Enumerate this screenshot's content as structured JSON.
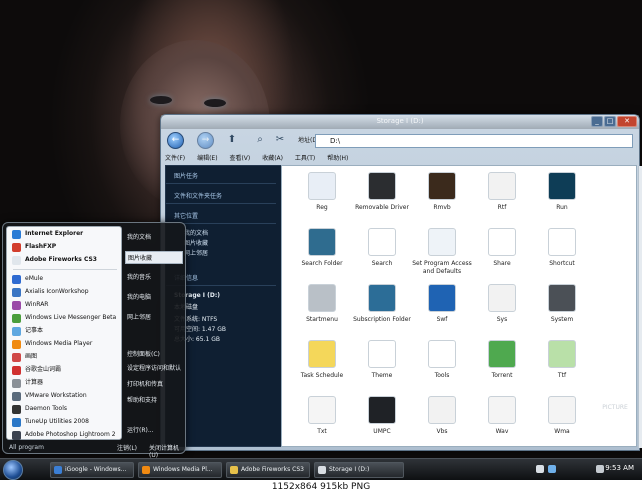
{
  "window": {
    "title": "Storage I (D:)",
    "address_label": "地址(D)",
    "address_value": "D:\\",
    "menu": [
      "文件(F)",
      "编辑(E)",
      "查看(V)",
      "收藏(A)",
      "工具(T)",
      "帮助(H)"
    ]
  },
  "sidepane": {
    "sections": [
      {
        "title": "图片任务"
      },
      {
        "title": "文件和文件夹任务"
      },
      {
        "title": "其它位置",
        "items": [
          "我的文档",
          "图片收藏",
          "网上邻居"
        ]
      },
      {
        "title": "详细信息"
      }
    ],
    "details": {
      "name": "Storage I (D:)",
      "type": "本地磁盘",
      "fs": "文件系统: NTFS",
      "free": "可用空间: 1.47 GB",
      "total": "总大小: 65.1 GB"
    }
  },
  "icons": [
    {
      "label": "Reg",
      "icon": "registry-icon",
      "color": "#e8eef6"
    },
    {
      "label": "Removable Driver",
      "icon": "removable-drive-icon",
      "color": "#2b2d30"
    },
    {
      "label": "Rmvb",
      "icon": "rmvb-file-icon",
      "color": "#3b2a1c"
    },
    {
      "label": "Rtf",
      "icon": "rtf-file-icon",
      "color": "#f2f2f2"
    },
    {
      "label": "Run",
      "icon": "run-icon",
      "color": "#0e3d56"
    },
    {
      "label": "Search Folder",
      "icon": "search-folder-icon",
      "color": "#2f6c8f"
    },
    {
      "label": "Search",
      "icon": "magnifier-icon",
      "color": "#ffffff"
    },
    {
      "label": "Set Program Access and Defaults",
      "icon": "program-defaults-icon",
      "color": "#eef3f8"
    },
    {
      "label": "Share",
      "icon": "share-icon",
      "color": "#ffffff"
    },
    {
      "label": "Shortcut",
      "icon": "shortcut-icon",
      "color": "#ffffff"
    },
    {
      "label": "Startmenu",
      "icon": "startmenu-icon",
      "color": "#b9c0c7"
    },
    {
      "label": "Subscription Folder",
      "icon": "subscription-folder-icon",
      "color": "#2c6d97"
    },
    {
      "label": "Swf",
      "icon": "flash-icon",
      "color": "#1f63b3"
    },
    {
      "label": "Sys",
      "icon": "sys-file-icon",
      "color": "#f2f2f2"
    },
    {
      "label": "System",
      "icon": "system-icon",
      "color": "#4b5056"
    },
    {
      "label": "Task Schedule",
      "icon": "task-schedule-icon",
      "color": "#f4d75a"
    },
    {
      "label": "Theme",
      "icon": "theme-icon",
      "color": "#ffffff"
    },
    {
      "label": "Tools",
      "icon": "tools-gear-icon",
      "color": "#ffffff"
    },
    {
      "label": "Torrent",
      "icon": "torrent-icon",
      "color": "#4fa94f"
    },
    {
      "label": "Ttf",
      "icon": "font-file-icon",
      "color": "#b9e0a8"
    },
    {
      "label": "Txt",
      "icon": "txt-file-icon",
      "color": "#f5f5f5"
    },
    {
      "label": "UMPC",
      "icon": "umpc-device-icon",
      "color": "#1f2226"
    },
    {
      "label": "Vbs",
      "icon": "vbs-file-icon",
      "color": "#f2f2f2"
    },
    {
      "label": "Wav",
      "icon": "wav-speaker-icon",
      "color": "#f4f4f4"
    },
    {
      "label": "Wma",
      "icon": "wma-speaker-icon",
      "color": "#f4f4f4"
    }
  ],
  "start_menu": {
    "pinned": [
      {
        "label": "Internet Explorer",
        "color": "#2a7bd5"
      },
      {
        "label": "FlashFXP",
        "color": "#d23d2d"
      },
      {
        "label": "Adobe Fireworks CS3",
        "color": "#e0e6ec"
      }
    ],
    "recent": [
      {
        "label": "eMule",
        "color": "#2e6ad1"
      },
      {
        "label": "Axialis IconWorkshop",
        "color": "#3a75c4"
      },
      {
        "label": "WinRAR",
        "color": "#9a4aa8"
      },
      {
        "label": "Windows Live Messenger Beta",
        "color": "#4a9e3c"
      },
      {
        "label": "记事本",
        "color": "#5ea7e0"
      },
      {
        "label": "Windows Media Player",
        "color": "#f08a12"
      },
      {
        "label": "画图",
        "color": "#d04848"
      },
      {
        "label": "谷歌金山词霸",
        "color": "#d03030"
      },
      {
        "label": "计算器",
        "color": "#8a9097"
      },
      {
        "label": "VMware Workstation",
        "color": "#5a6a7c"
      },
      {
        "label": "Daemon Tools",
        "color": "#333333"
      },
      {
        "label": "TuneUp Utilities 2008",
        "color": "#2b77c7"
      },
      {
        "label": "Adobe Photoshop Lightroom 2",
        "color": "#3b4250"
      }
    ],
    "right": [
      "我的文档",
      "图片收藏",
      "我的音乐",
      "我的电脑",
      "网上邻居",
      "控制面板(C)",
      "设定程序访问和默认",
      "打印机和传真",
      "帮助和支持",
      "运行(R)..."
    ],
    "all_programs": "All program",
    "logoff": "注销(L)",
    "shutdown": "关闭计算机(U)"
  },
  "taskbar": {
    "tasks": [
      {
        "label": "iGoogle - Windows...",
        "color": "#3b7fd6"
      },
      {
        "label": "Windows Media Pl...",
        "color": "#f08a12"
      },
      {
        "label": "Adobe Fireworks CS3",
        "color": "#e7c14a"
      },
      {
        "label": "Storage I (D:)",
        "color": "#d8dde2"
      }
    ],
    "clock": "9:53 AM"
  },
  "watermark": "PICTURE",
  "footer": "1152x864  915kb  PNG"
}
